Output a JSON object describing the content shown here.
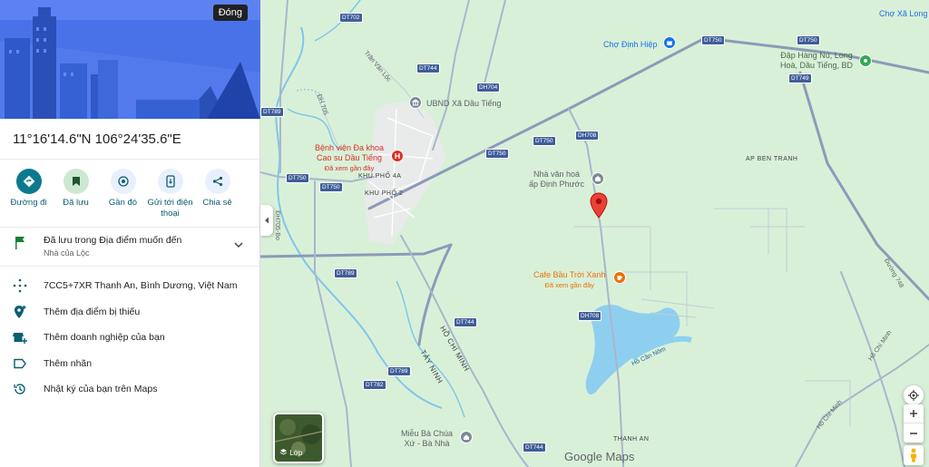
{
  "panel": {
    "close_label": "Đóng",
    "coordinates": "11°16'14.6\"N 106°24'35.6\"E",
    "actions": [
      {
        "icon": "directions-icon",
        "label": "Đường đi"
      },
      {
        "icon": "bookmark-icon",
        "label": "Đã lưu"
      },
      {
        "icon": "nearby-icon",
        "label": "Gần đó"
      },
      {
        "icon": "send-to-phone-icon",
        "label": "Gửi tới điện thoại"
      },
      {
        "icon": "share-icon",
        "label": "Chia sẻ"
      }
    ],
    "saved": {
      "title": "Đã lưu trong Địa điểm muốn đến",
      "subtitle": "Nhà của Lộc"
    },
    "info_rows": [
      {
        "icon": "plus-code-icon",
        "label": "7CC5+7XR Thanh An, Bình Dương, Việt Nam"
      },
      {
        "icon": "add-place-icon",
        "label": "Thêm địa điểm bị thiếu"
      },
      {
        "icon": "add-business-icon",
        "label": "Thêm doanh nghiệp của bạn"
      },
      {
        "icon": "label-icon",
        "label": "Thêm nhãn"
      },
      {
        "icon": "history-icon",
        "label": "Nhật ký của bạn trên Maps"
      }
    ]
  },
  "map": {
    "places": {
      "cho_xa_long": "Chợ Xã Long",
      "cho_dinh_hiep": "Chợ Định Hiệp",
      "dap_hang_nu_1": "Đập Hàng Nù, Long",
      "dap_hang_nu_2": "Hoà, Dầu Tiếng, BD",
      "ubnd": "UBND Xã Dầu Tiếng",
      "benh_vien_1": "Bệnh viện Đa khoa",
      "benh_vien_2": "Cao su Dầu Tiếng",
      "benh_vien_sub": "Đã xem gần đây",
      "nha_van_hoa_1": "Nhà văn hoá",
      "nha_van_hoa_2": "ấp Định Phước",
      "cafe": "Cafe Bầu Trời Xanh",
      "cafe_sub": "Đã xem gần đây",
      "mieu_1": "Miễu Bà Chúa",
      "mieu_2": "Xứ - Bà Nhà"
    },
    "areas": {
      "khu_pho_4a": "KHU PHỐ 4A",
      "khu_pho_2": "KHU PHỐ 2",
      "ap_ben_tranh": "AP BEN TRANH",
      "thanh_an": "THANH AN",
      "ho_chi_minh": "HỒ CHÍ MINH",
      "tay_ninh": "TÂY NINH",
      "ho_can_nom": "Hồ Cần Nôm",
      "tran_van_loc": "Trần Văn Lộc",
      "duong_748": "Đường 748",
      "ho_chi_minh_road_1": "Hồ Chí Minh",
      "ho_chi_minh_road_2": "Hồ Chí Minh",
      "dh705": "ĐH 705",
      "dh705_bo": "ĐH705-Bo"
    },
    "shields": {
      "s1": "DT702",
      "s2": "DT744",
      "s3": "DH704",
      "s4": "DT789",
      "s5": "DT750",
      "s6": "DT750",
      "s7": "DT750",
      "s8": "DH708",
      "s9": "DT750",
      "s10": "DT750",
      "s11": "DT749",
      "s12": "DT789",
      "s13": "DT744",
      "s14": "DT789",
      "s15": "DT782",
      "s16": "DH708",
      "s17": "DT744"
    },
    "layer_label": "Lớp",
    "attribution": "Google Maps"
  },
  "colors": {
    "map_land": "#d9f0d8",
    "water": "#7fc7ea",
    "road_major": "#8b9bb8",
    "accent": "#0b7a8e"
  }
}
